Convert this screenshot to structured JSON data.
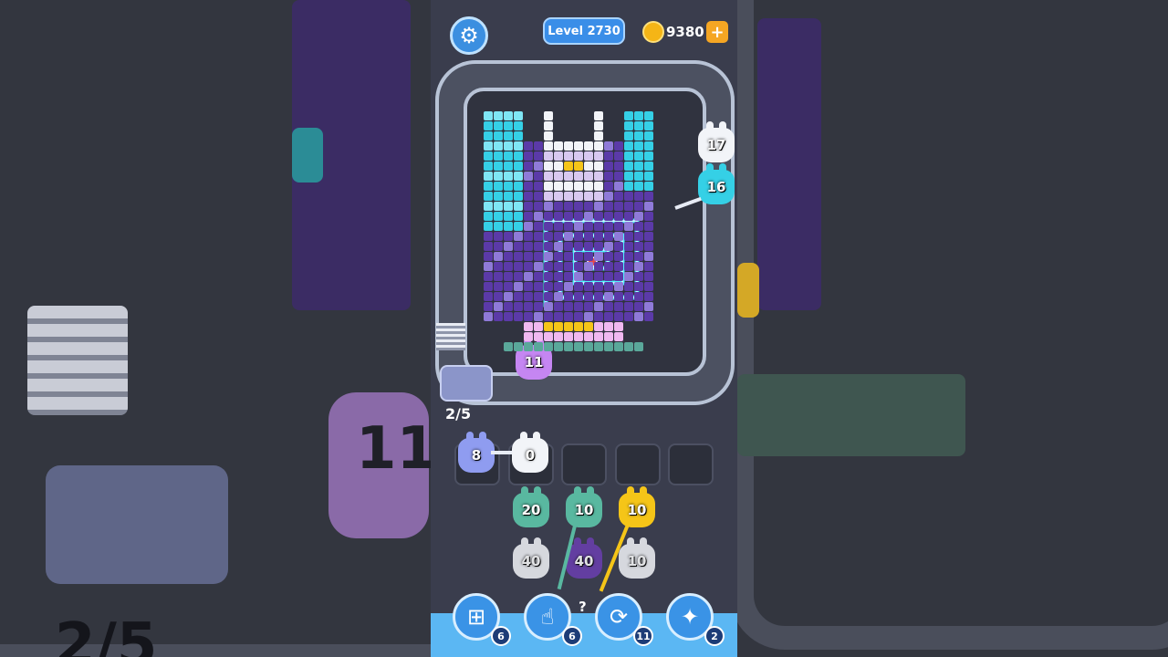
{
  "header": {
    "level_label": "Level 2730",
    "coins": "9380",
    "add_coins_symbol": "+"
  },
  "board": {
    "queue_progress": "2/5",
    "conveyor_critters": [
      {
        "count": "17",
        "color": "#f2f4f8"
      },
      {
        "count": "16",
        "color": "#35d0e6"
      },
      {
        "count": "11",
        "color": "#c586f2"
      }
    ]
  },
  "holding_slots": [
    {
      "count": "8",
      "color": "#8f9cf0",
      "empty": false
    },
    {
      "count": "0",
      "color": "#f2f4f8",
      "empty": false
    },
    {
      "count": "",
      "empty": true
    },
    {
      "count": "",
      "empty": true
    },
    {
      "count": "",
      "empty": true
    }
  ],
  "columns": [
    {
      "top": {
        "count": "20",
        "color": "#59b8a0"
      },
      "second": {
        "count": "40",
        "color": "#f2f4f8"
      }
    },
    {
      "top": {
        "count": "10",
        "color": "#59b8a0"
      },
      "second": {
        "count": "40",
        "color": "#6b3fb0"
      }
    },
    {
      "top": {
        "count": "10",
        "color": "#f5c518"
      },
      "second": {
        "count": "10",
        "color": "#f2f4f8"
      }
    }
  ],
  "hidden_marker": "?",
  "boosters": [
    {
      "icon": "add-slot-icon",
      "count": "6"
    },
    {
      "icon": "tap-hand-icon",
      "count": "6"
    },
    {
      "icon": "shuffle-icon",
      "count": "11"
    },
    {
      "icon": "magic-critter-icon",
      "count": "2"
    }
  ],
  "background": {
    "blurred_count": "11",
    "blurred_progress": "2/5"
  }
}
